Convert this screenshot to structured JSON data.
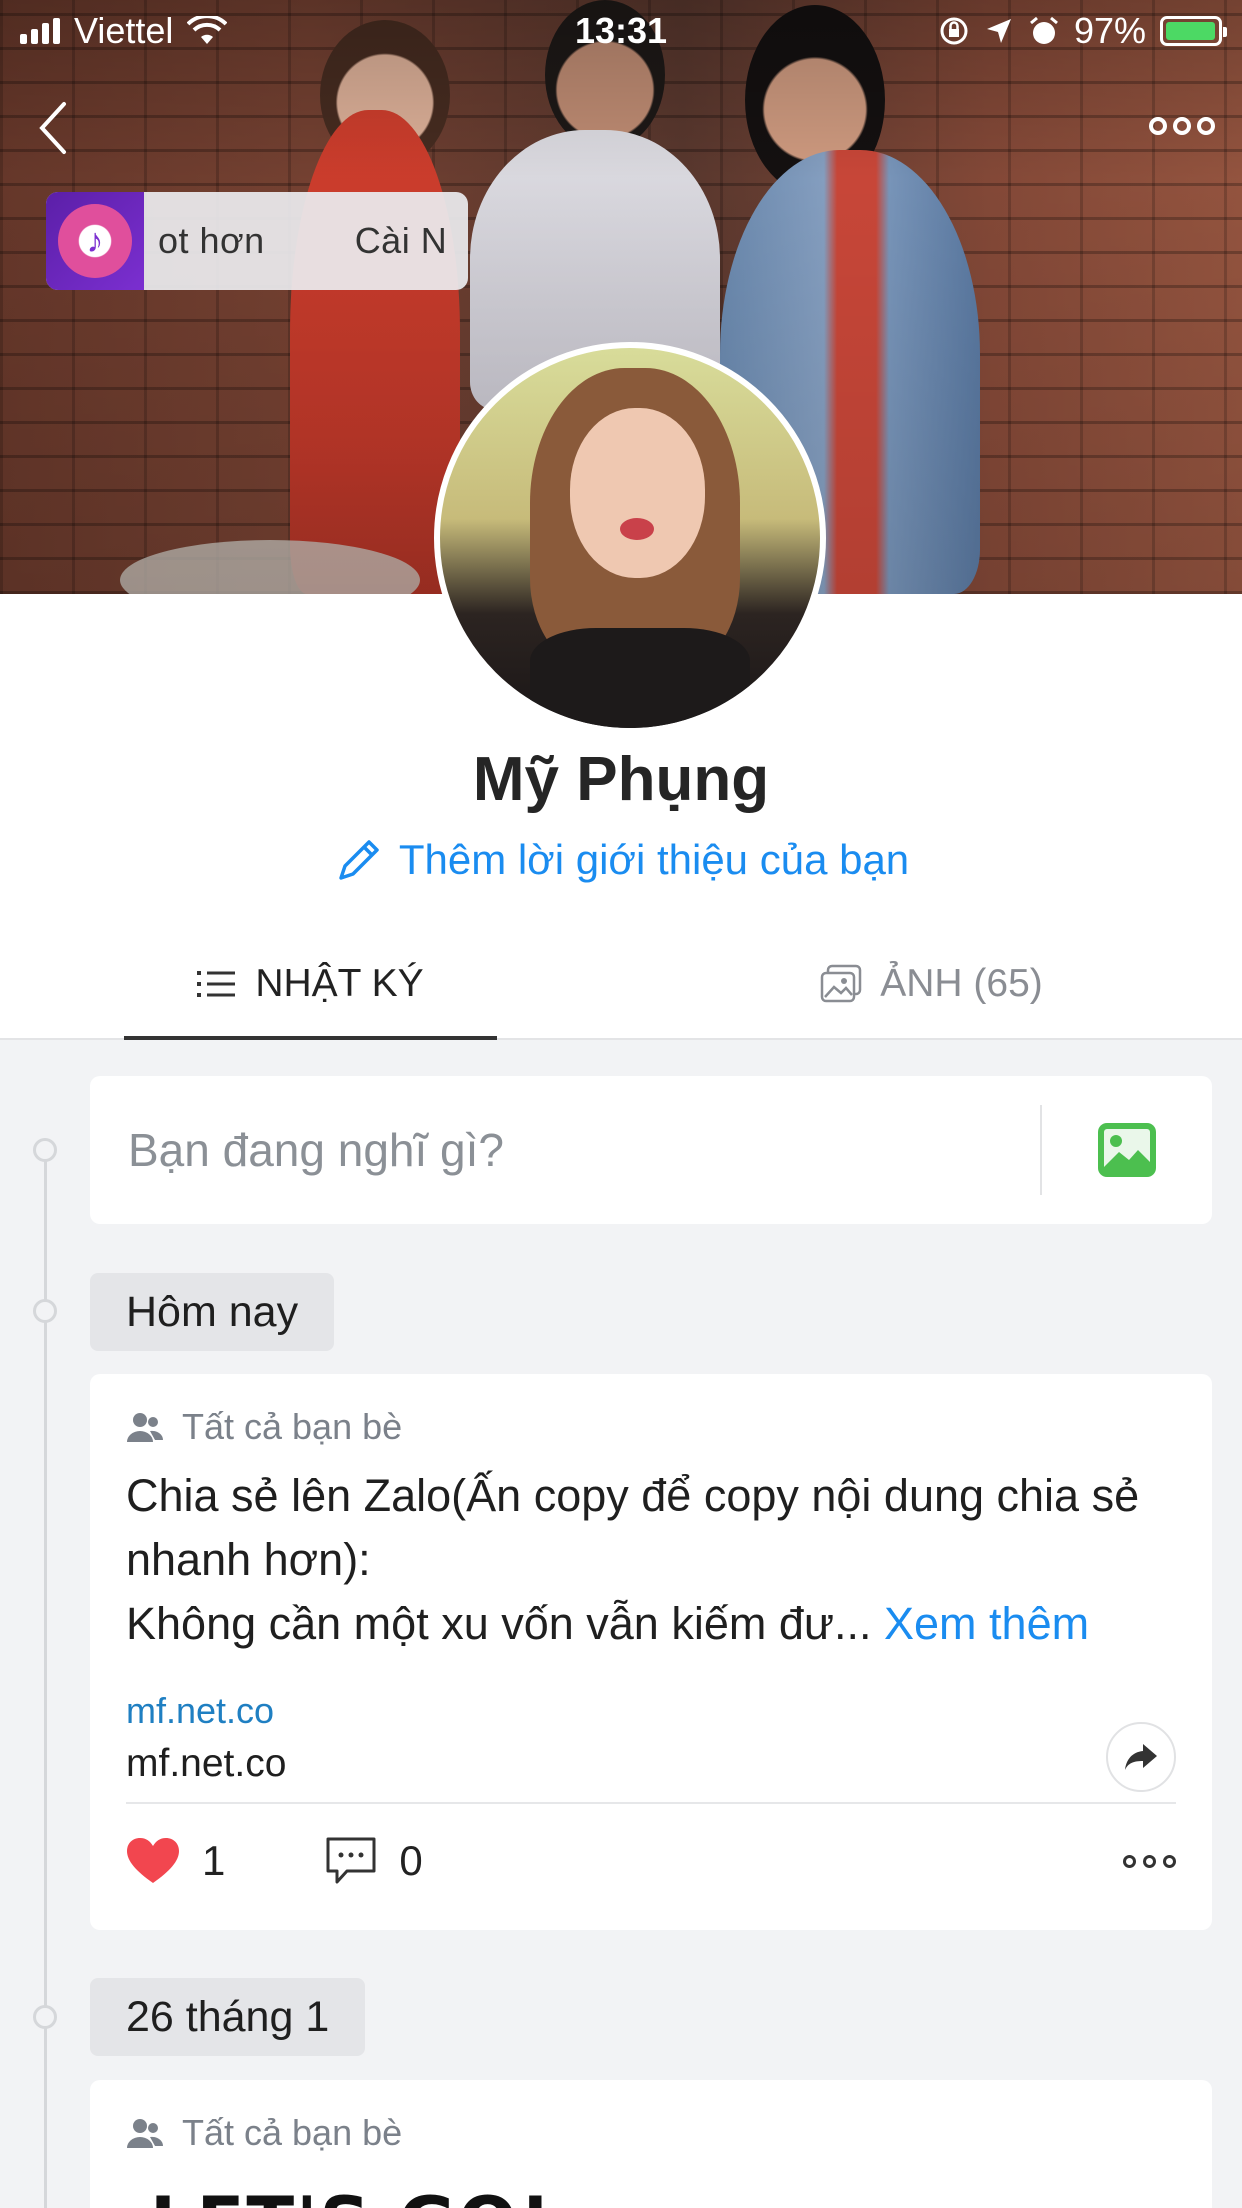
{
  "status_bar": {
    "carrier": "Viettel",
    "time": "13:31",
    "battery": "97%",
    "battery_level": 0.97
  },
  "music_widget": {
    "text_left": "ot hơn",
    "text_right": "Cài N"
  },
  "profile": {
    "name": "Mỹ Phụng",
    "add_intro": "Thêm lời giới thiệu của bạn"
  },
  "tabs": [
    {
      "label": "NHẬT KÝ",
      "icon": "list-icon",
      "active": true
    },
    {
      "label": "ẢNH (65)",
      "icon": "gallery-icon",
      "active": false
    }
  ],
  "composer": {
    "placeholder": "Bạn đang nghĩ gì?"
  },
  "feed": {
    "date_today": "Hôm nay",
    "date_second": "26 tháng 1",
    "post1": {
      "privacy": "Tất cả bạn bè",
      "body_line1": "Chia sẻ lên Zalo(Ấn copy để copy nội dung chia sẻ nhanh hơn):",
      "body_line2": "Không cần một xu vốn vẫn kiếm đư... ",
      "see_more": "Xem thêm",
      "link_domain": "mf.net.co",
      "link_title": "mf.net.co",
      "likes": "1",
      "comments": "0"
    },
    "post2": {
      "privacy": "Tất cả bạn bè",
      "image_text": "LET'S GO!"
    }
  },
  "colors": {
    "accent": "#1a8cf0",
    "like": "#f2464f",
    "photo_icon": "#4cbf4f",
    "background": "#f2f3f5"
  }
}
